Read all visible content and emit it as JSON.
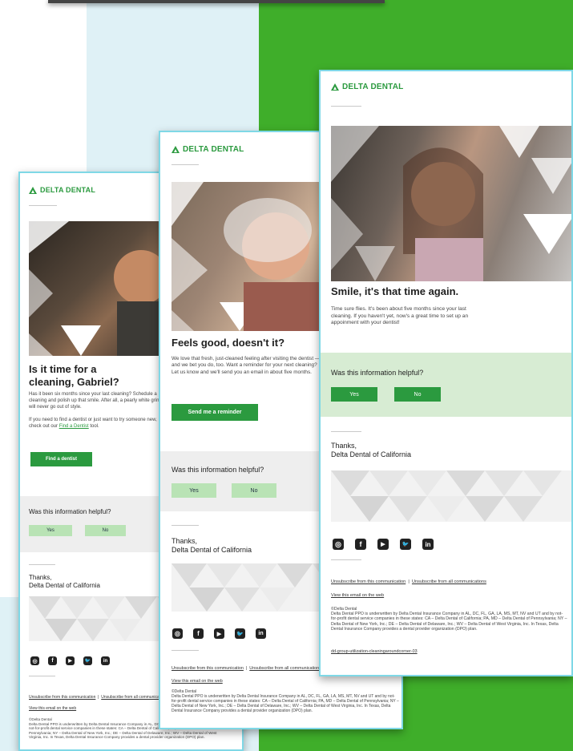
{
  "brand": {
    "logo_text": "DELTA DENTAL",
    "green": "#2b9a3f",
    "pale_green": "#b9e3b5",
    "panel_green": "#d7ecd3",
    "cyan_border": "#7fd8e6"
  },
  "card_left": {
    "headline": "Is it time for a cleaning, Gabriel?",
    "para1": "Has it been six months since your last cleaning? Schedule a cleaning and polish up that smile. After all, a pearly white grin will never go out of style.",
    "para2_prefix": "If you need to find a dentist or just want to try someone new, check out our ",
    "para2_link": "Find a Dentist",
    "para2_suffix": " tool.",
    "cta": "Find a dentist",
    "helpful_q": "Was this information helpful?",
    "yes": "Yes",
    "no": "No",
    "thanks_1": "Thanks,",
    "thanks_2": "Delta Dental of California",
    "unsub_one": "Unsubscribe from this communication",
    "unsub_all": "Unsubscribe from all communications",
    "view_web": "View this email on the web",
    "copyright": "©Delta Dental",
    "legal": "Delta Dental PPO is underwritten by Delta Dental Insurance Company in AL, DC, FL, GA, LA, MS, MT, NV and UT and by not-for-profit dental service companies in these states: CA – Delta Dental of California; PA, MD – Delta Dental of Pennsylvania; NY – Delta Dental of New York, Inc.; DE – Delta Dental of Delaware, Inc.; WV – Delta Dental of West Virginia, Inc. In Texas, Delta Dental Insurance Company provides a dental provider organization (DPO) plan."
  },
  "card_middle": {
    "headline": "Feels good, doesn't it?",
    "para": "We love that fresh, just-cleaned feeling after visiting the dentist — and we bet you do, too. Want a reminder for your next cleaning? Let us know and we'll send you an email in about five months.",
    "cta": "Send me a reminder",
    "helpful_q": "Was this information helpful?",
    "yes": "Yes",
    "no": "No",
    "thanks_1": "Thanks,",
    "thanks_2": "Delta Dental of California",
    "unsub_one": "Unsubscribe from this communication",
    "unsub_all": "Unsubscribe from all communications",
    "view_web": "View this email on the web",
    "copyright": "©Delta Dental",
    "legal": "Delta Dental PPO is underwritten by Delta Dental Insurance Company in AL, DC, FL, GA, LA, MS, MT, NV and UT and by not-for-profit dental service companies in these states: CA – Delta Dental of California; PA, MD – Delta Dental of Pennsylvania; NY – Delta Dental of New York, Inc.; DE – Delta Dental of Delaware, Inc.; WV – Delta Dental of West Virginia, Inc. In Texas, Delta Dental Insurance Company provides a dental provider organization (DPO) plan."
  },
  "card_right": {
    "headline": "Smile, it's that time again.",
    "para": "Time sure flies. It's been about five months since your last cleaning. If you haven't yet, now's a great time to set up an appoinment with your dentist!",
    "helpful_q": "Was this information helpful?",
    "yes": "Yes",
    "no": "No",
    "thanks_1": "Thanks,",
    "thanks_2": "Delta Dental of California",
    "unsub_one": "Unsubscribe from this communication",
    "unsub_all": "Unsubscribe from all communications",
    "view_web": "View this email on the web",
    "copyright": "©Delta Dental",
    "legal": "Delta Dental PPO is underwritten by Delta Dental Insurance Company in AL, DC, FL, GA, LA, MS, MT, NV and UT and by not-for-profit dental service companies in these states: CA – Delta Dental of California; PA, MD – Delta Dental of Pennsylvania; NY – Delta Dental of New York, Inc.; DE – Delta Dental of Delaware, Inc.; WV – Delta Dental of West Virginia, Inc. In Texas, Delta Dental Insurance Company provides a dental provider organization (DPO) plan.",
    "campaign_id": "dd-group-utilization-cleaningaroundcorner-03"
  },
  "social_icons": [
    "instagram-icon",
    "facebook-icon",
    "youtube-icon",
    "twitter-icon",
    "linkedin-icon"
  ],
  "social_glyphs": [
    "◎",
    "f",
    "▶",
    "🐦",
    "in"
  ]
}
